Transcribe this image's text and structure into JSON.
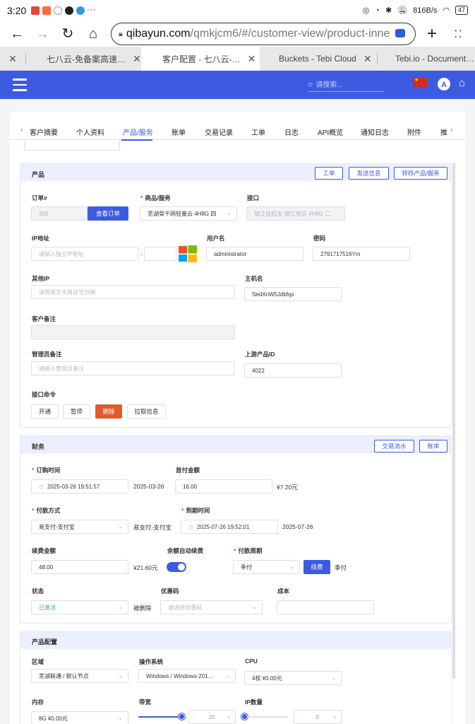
{
  "status_bar": {
    "time": "3:20",
    "net_speed": "816B/s",
    "battery": "47"
  },
  "browser": {
    "url_host": "qibayun.com",
    "url_path": "/qmkjcm6/#/customer-view/product-inne",
    "tabs": [
      {
        "title": "七八云-免备案高速…"
      },
      {
        "title": "客户配置 - 七八云-…"
      },
      {
        "title": "Buckets - Tebi Cloud"
      },
      {
        "title": "Tebi.io - Document…"
      }
    ]
  },
  "app_header": {
    "search_placeholder": "请搜索...",
    "avatar_letter": "A"
  },
  "customer_tabs": [
    "客户摘要",
    "个人资料",
    "产品/服务",
    "账单",
    "交易记录",
    "工单",
    "日志",
    "API概览",
    "通知日志",
    "附件",
    "推"
  ],
  "product": {
    "title": "产品",
    "buttons": {
      "ticket": "工单",
      "send_info": "发送信息",
      "transfer": "转移产品/服务"
    },
    "order_label": "订单#",
    "order_value": "308",
    "view_order": "查看订单",
    "goods_label": "商品/服务",
    "goods_value": "芜湖骨干网轻量云 4H8G 四",
    "interface_label": "接口",
    "interface_value": "镇江挂机宝-镇江电信 4H8G 二",
    "ip_label": "IP地址",
    "ip_placeholder": "请输入独立IP地址",
    "ip_sep": ":",
    "username_label": "用户名",
    "username_value": "administrator",
    "password_label": "密码",
    "password_value": "2791717516Ym",
    "other_ip_label": "其他IP",
    "other_ip_placeholder": "请用英文半角逗号分隔",
    "hostname_label": "主机名",
    "hostname_value": "SedXnW5Jdbfqs",
    "customer_note_label": "客户备注",
    "admin_note_label": "管理员备注",
    "admin_note_placeholder": "请输入管理员备注",
    "upstream_label": "上游产品ID",
    "upstream_value": "4022",
    "cmd_label": "接口命令",
    "cmds": {
      "open": "开通",
      "pause": "暂停",
      "delete": "删除",
      "pull": "拉取信息"
    }
  },
  "finance": {
    "title": "财务",
    "buttons": {
      "flow": "交易流水",
      "bill": "账单"
    },
    "order_time_label": "订购时间",
    "order_time_value": "2025-03-26 19:51:57",
    "order_date_text": "2025-03-26",
    "first_pay_label": "首付金额",
    "first_pay_value": "16.00",
    "first_pay_text": "¥7.20元",
    "pay_method_label": "付款方式",
    "pay_method_value": "易支付-支付宝",
    "pay_method_text": "易支付-支付宝",
    "expire_label": "到期时间",
    "expire_value": "2025-07-26 19:52:01",
    "expire_text": "2025-07-26",
    "renew_label": "续费金额",
    "renew_value": "48.00",
    "renew_text": "¥21.60元",
    "auto_renew_label": "余额自动续费",
    "auto_renew_on": true,
    "cycle_label": "付款周期",
    "cycle_value": "季付",
    "renew_button": "续费",
    "cycle_text": "季付",
    "status_label": "状态",
    "status_value": "已激活",
    "status_text": "被删除",
    "coupon_label": "优惠码",
    "coupon_placeholder": "请选择优惠码",
    "cost_label": "成本"
  },
  "config": {
    "title": "产品配置",
    "region_label": "区域",
    "region_value": "芜湖联通 / 默认节点",
    "os_label": "操作系统",
    "os_value": "Windows / Windows-201…",
    "cpu_label": "CPU",
    "cpu_value": "4核 ¥0.00元",
    "mem_label": "内存",
    "mem_value": "8G ¥0.00元",
    "bw_label": "带宽",
    "bw_value": "20",
    "ipcount_label": "IP数量",
    "ipcount_value": "0"
  },
  "colors": {
    "brand": "#3d5be0",
    "danger": "#e05a2c",
    "active_status": "#3cb371"
  }
}
